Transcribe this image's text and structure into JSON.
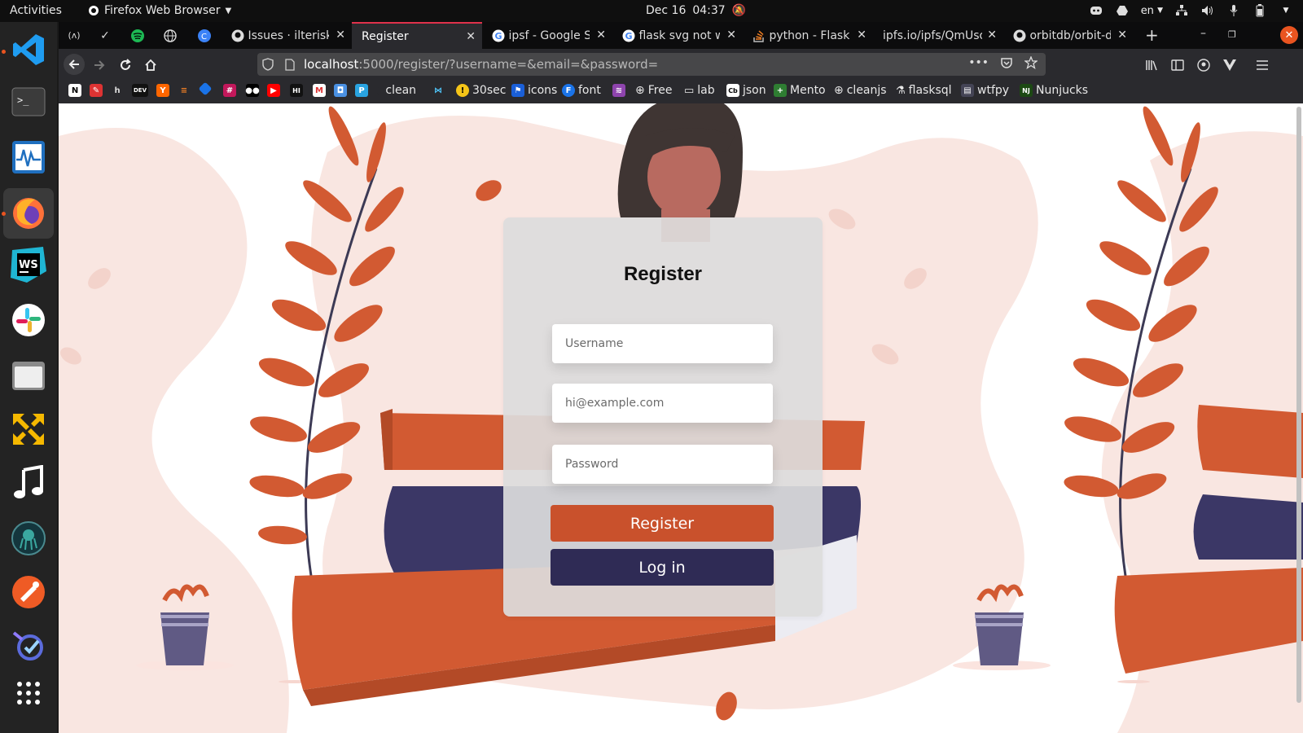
{
  "topbar": {
    "activities": "Activities",
    "app_name": "Firefox Web Browser",
    "date": "Dec 16",
    "time": "04:37",
    "language": "en"
  },
  "tabs": [
    {
      "title": "Issues · ilteriske"
    },
    {
      "title": "Register"
    },
    {
      "title": "ipsf - Google Se"
    },
    {
      "title": "flask svg not wo"
    },
    {
      "title": "python - Flask a"
    },
    {
      "title": "ipfs.io/ipfs/QmUso"
    },
    {
      "title": "orbitdb/orbit-d"
    }
  ],
  "pinned_tabs": [
    "(ʌ)",
    "✓",
    "spotify",
    "globe",
    "c"
  ],
  "url": {
    "host": "localhost",
    "path": ":5000/register/?username=&email=&password="
  },
  "bookmarks": [
    "clean",
    "30sec",
    "icons",
    "font",
    "Free",
    "lab",
    "json",
    "Mento",
    "cleanjs",
    "flasksql",
    "wtfpy",
    "Nunjucks"
  ],
  "form": {
    "title": "Register",
    "username_placeholder": "Username",
    "email_placeholder": "hi@example.com",
    "password_placeholder": "Password",
    "register_label": "Register",
    "login_label": "Log in"
  },
  "colors": {
    "accent": "#c9512c",
    "dark": "#2f2b55",
    "blob": "#f9e6e1"
  }
}
